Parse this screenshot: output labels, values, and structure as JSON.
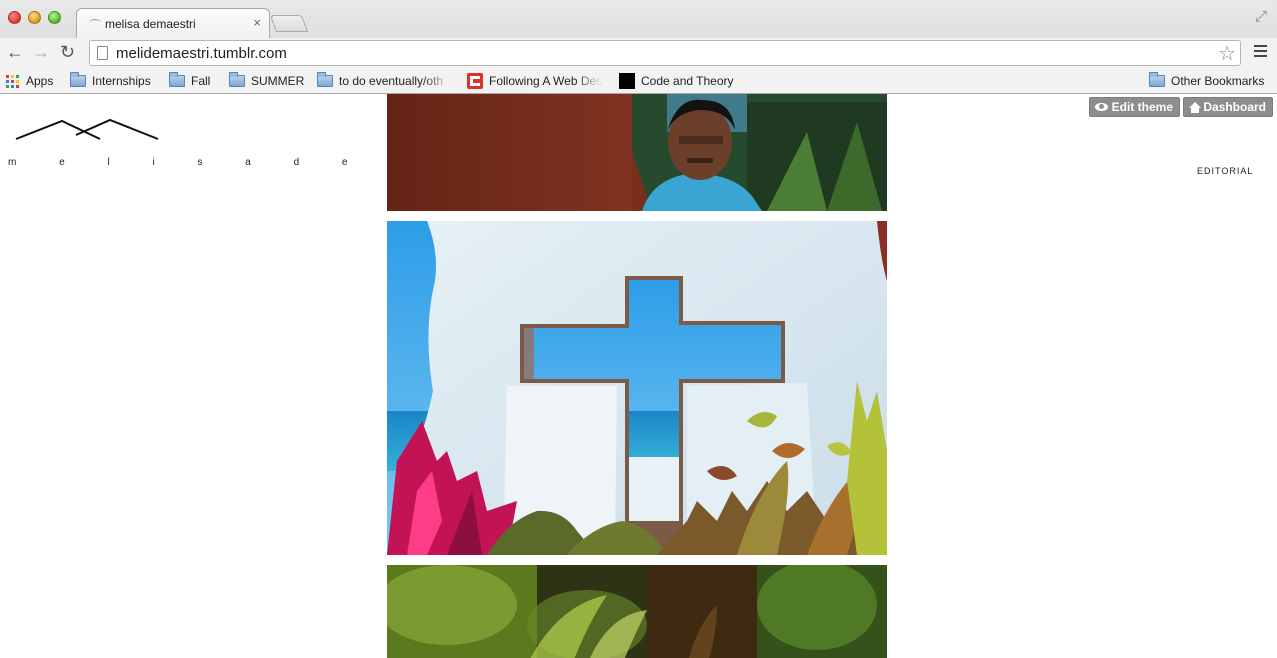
{
  "browser": {
    "tab": {
      "title": "melisa demaestri",
      "close": "×"
    },
    "url": "melidemaestri.tumblr.com",
    "nav": {
      "back": "←",
      "forward": "→",
      "reload": "↻",
      "star": "☆",
      "fullscreen": "⤢"
    },
    "bookmarks": [
      {
        "label": "Apps",
        "icon": "apps-grid-icon"
      },
      {
        "label": "Internships",
        "icon": "folder-icon"
      },
      {
        "label": "Fall",
        "icon": "folder-icon"
      },
      {
        "label": "SUMMER",
        "icon": "folder-icon"
      },
      {
        "label": "to do eventually/oth",
        "icon": "folder-icon"
      },
      {
        "label": "Following A Web Des",
        "icon": "web-design-icon"
      },
      {
        "label": "Code and Theory",
        "icon": "code-and-theory-icon"
      }
    ],
    "other_bookmarks": "Other Bookmarks"
  },
  "site": {
    "name": "m e l i s a   d e m a e s t r i",
    "edit_theme": "Edit theme",
    "dashboard": "Dashboard",
    "nav_editorial": "EDITORIAL"
  },
  "posts": [
    {
      "subject": "man-in-blue-shirt-photo"
    },
    {
      "subject": "white-wall-cross-window-photo"
    },
    {
      "subject": "tropical-foliage-photo"
    }
  ]
}
